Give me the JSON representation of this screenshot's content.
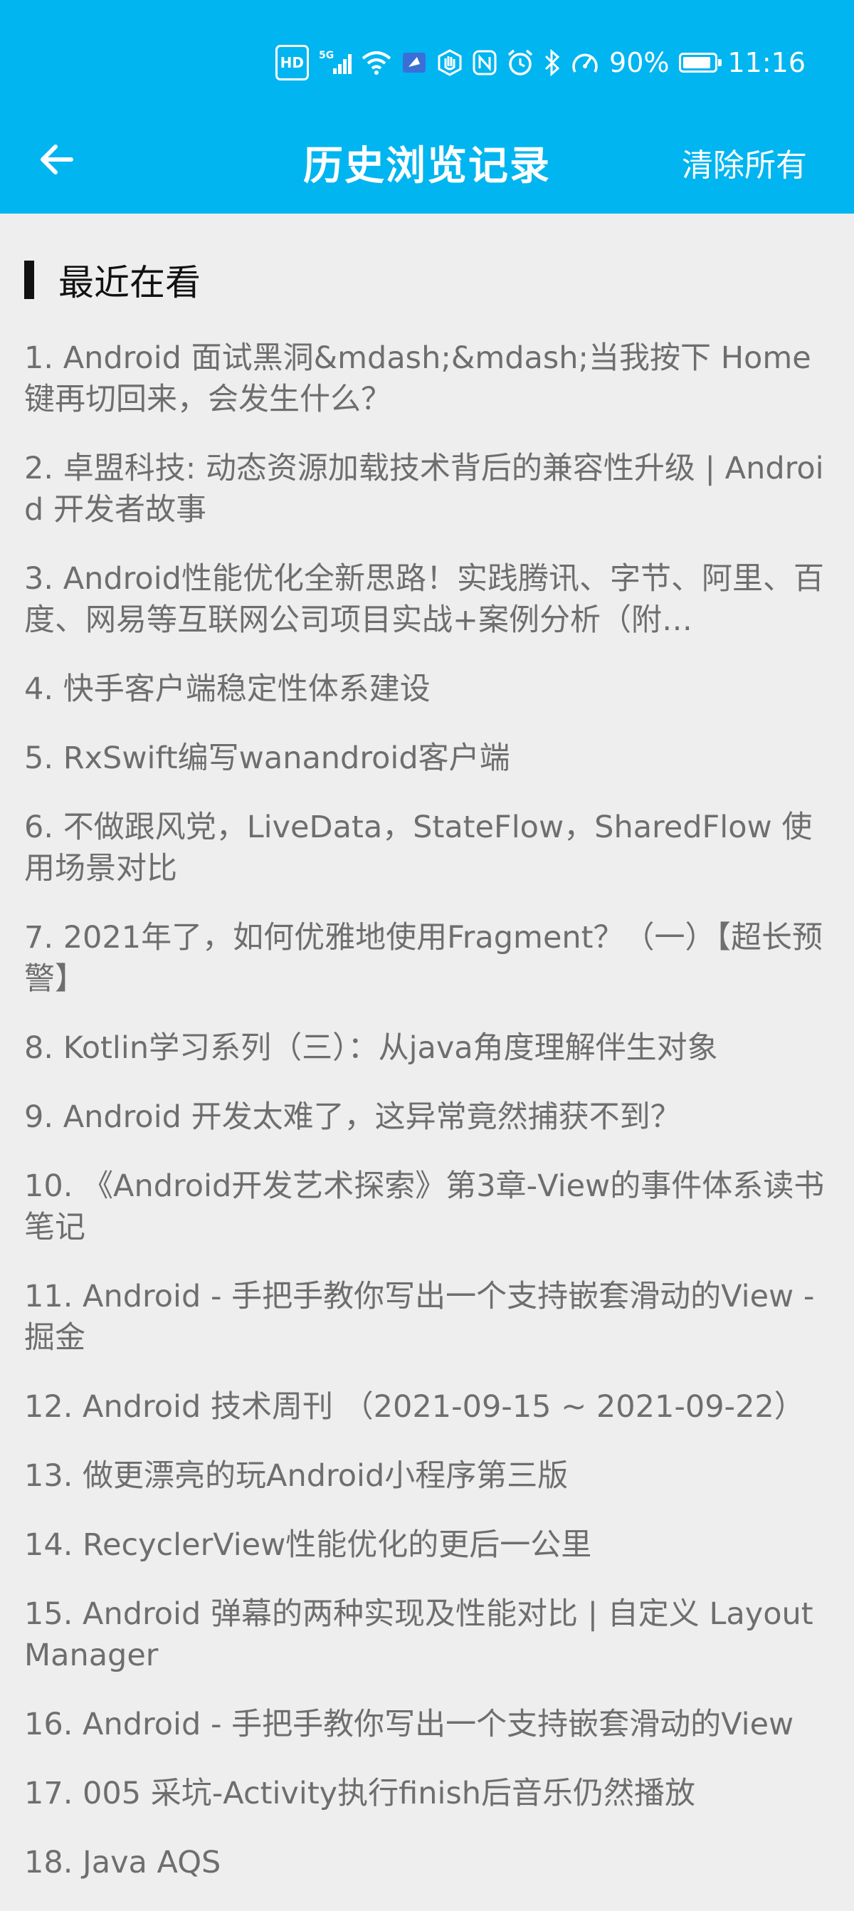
{
  "status_bar": {
    "hd": "HD",
    "network": "5G",
    "battery_percent": "90%",
    "battery_level": 0.9,
    "time": "11:16",
    "icons": [
      "hd-icon",
      "signal-5g-icon",
      "wifi-icon",
      "app-notification-icon",
      "hand-icon",
      "nfc-icon",
      "alarm-icon",
      "bluetooth-icon",
      "speed-icon",
      "battery-charging-icon"
    ]
  },
  "header": {
    "back_icon": "arrow-left-icon",
    "title": "历史浏览记录",
    "clear_all_label": "清除所有",
    "background_color": "#00b5f0"
  },
  "section": {
    "title": "最近在看"
  },
  "history": [
    "1. Android 面试黑洞&mdash;&mdash;当我按下 Home 键再切回来，会发生什么？",
    "2. 卓盟科技: 动态资源加载技术背后的兼容性升级 | Android 开发者故事",
    "3. Android性能优化全新思路！实践腾讯、字节、阿里、百度、网易等互联网公司项目实战+案例分析（附…",
    "4. 快手客户端稳定性体系建设",
    "5. RxSwift编写wanandroid客户端",
    "6. 不做跟风党，LiveData，StateFlow，SharedFlow 使用场景对比",
    "7. 2021年了，如何优雅地使用Fragment？（一）【超长预警】",
    "8. Kotlin学习系列（三）：从java角度理解伴生对象",
    "9. Android 开发太难了，这异常竟然捕获不到？",
    "10. 《Android开发艺术探索》第3章-View的事件体系读书笔记",
    "11. Android - 手把手教你写出一个支持嵌套滑动的View - 掘金",
    "12. Android 技术周刊 （2021-09-15 ~ 2021-09-22）",
    "13. 做更漂亮的玩Android小程序第三版",
    "14. RecyclerView性能优化的更后一公里",
    "15. Android 弹幕的两种实现及性能对比 | 自定义 LayoutManager",
    "16. Android - 手把手教你写出一个支持嵌套滑动的View",
    "17. 005 采坑-Activity执行finish后音乐仍然播放",
    "18. Java AQS"
  ]
}
